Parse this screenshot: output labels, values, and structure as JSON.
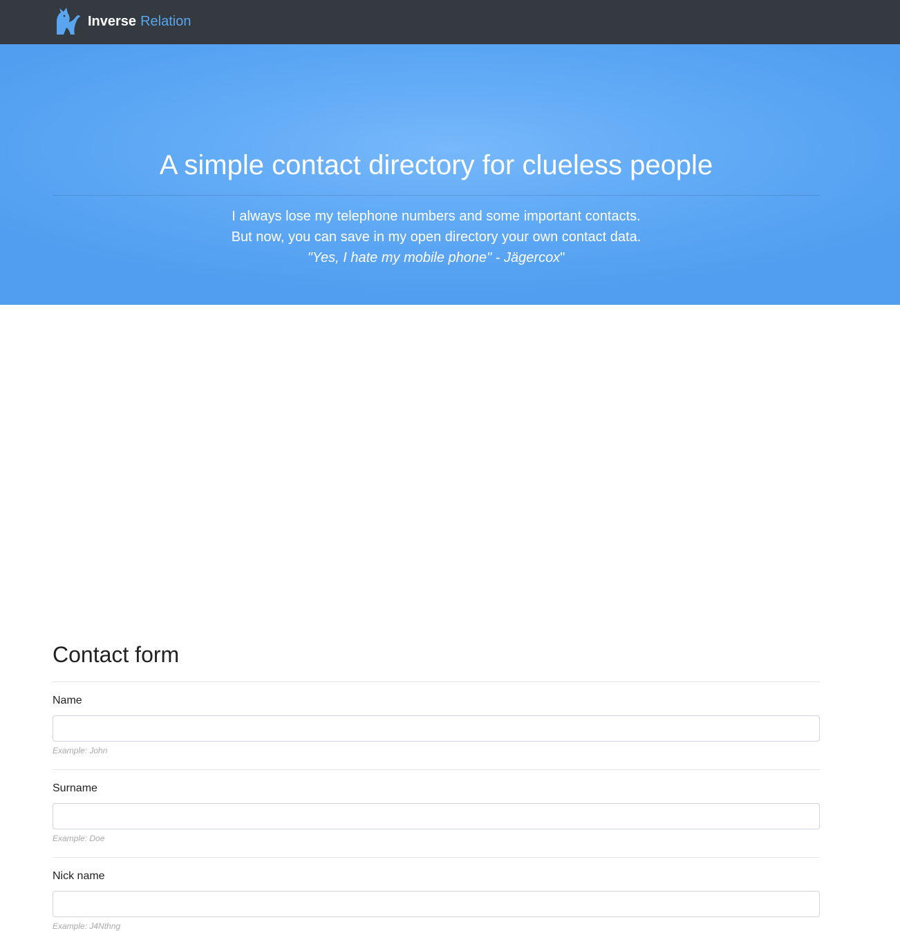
{
  "navbar": {
    "brand_bold": "Inverse",
    "brand_light": "Relation",
    "logo_icon": "fox-logo-icon"
  },
  "hero": {
    "title": "A simple contact directory for clueless people",
    "line1": "I always lose my telephone numbers and some important contacts.",
    "line2": "But now, you can save in my open directory your own contact data.",
    "quote": "\"Yes, I hate my mobile phone\" - Jägercox",
    "quote_tail": "\""
  },
  "form": {
    "title": "Contact form",
    "fields": [
      {
        "label": "Name",
        "value": "",
        "help": "Example: John"
      },
      {
        "label": "Surname",
        "value": "",
        "help": "Example: Doe"
      },
      {
        "label": "Nick name",
        "value": "",
        "help": "Example: J4Nthng"
      }
    ]
  },
  "colors": {
    "navbar_bg": "#343a40",
    "brand_accent": "#5aa5f0",
    "hero_bg": "#62abf6"
  }
}
